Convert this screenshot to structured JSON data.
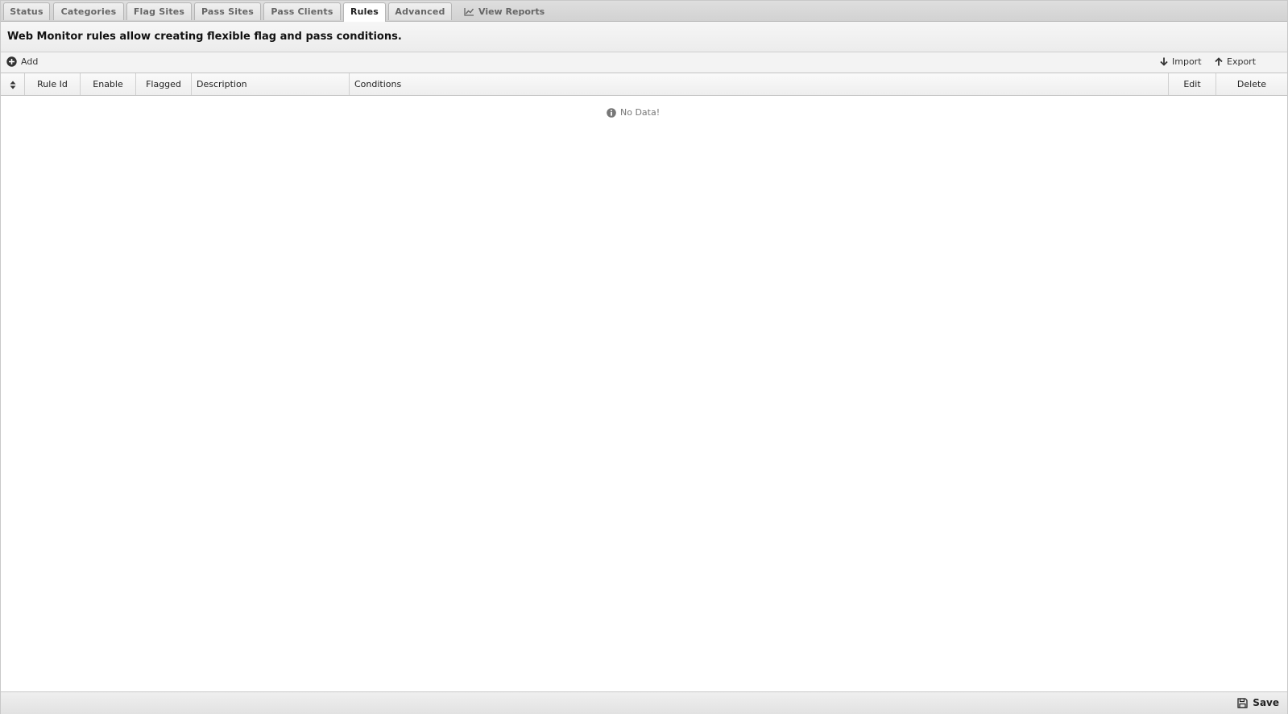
{
  "tabs": [
    {
      "label": "Status"
    },
    {
      "label": "Categories"
    },
    {
      "label": "Flag Sites"
    },
    {
      "label": "Pass Sites"
    },
    {
      "label": "Pass Clients"
    },
    {
      "label": "Rules",
      "active": true
    },
    {
      "label": "Advanced"
    }
  ],
  "reports_link": {
    "label": "View Reports",
    "icon": "line-chart-icon"
  },
  "banner": {
    "text": "Web Monitor rules allow creating flexible flag and pass conditions."
  },
  "toolbar": {
    "add_label": "Add",
    "import_label": "Import",
    "export_label": "Export"
  },
  "grid": {
    "columns": [
      "Rule Id",
      "Enable",
      "Flagged",
      "Description",
      "Conditions",
      "Edit",
      "Delete"
    ],
    "empty_message": "No Data!"
  },
  "footer": {
    "save_label": "Save"
  },
  "colors": {
    "tab_bar": "#d6d6d6",
    "banner_bg": "#f0f0f0",
    "text": "#222222",
    "muted_text": "#777777"
  }
}
